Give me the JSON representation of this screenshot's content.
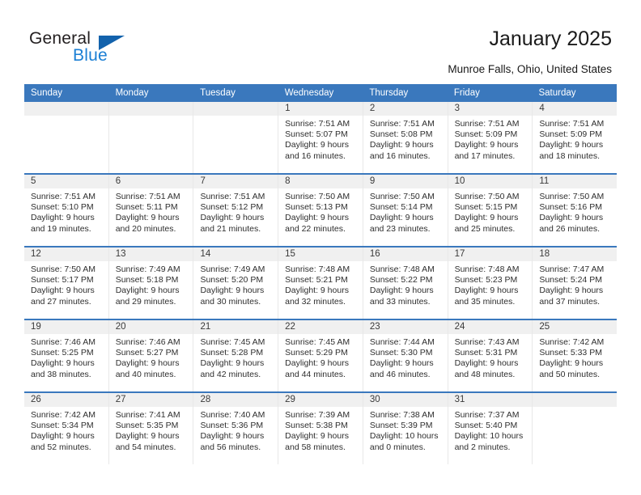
{
  "brand": {
    "name_top": "General",
    "name_bottom": "Blue",
    "accent_color": "#1262ac",
    "text_color": "#231f20"
  },
  "header": {
    "title": "January 2025",
    "subtitle": "Munroe Falls, Ohio, United States"
  },
  "calendar": {
    "header_bg": "#3a78bd",
    "daynum_bg": "#f0f0f0",
    "day_headers": [
      "Sunday",
      "Monday",
      "Tuesday",
      "Wednesday",
      "Thursday",
      "Friday",
      "Saturday"
    ],
    "weeks": [
      [
        {
          "day": "",
          "empty": true
        },
        {
          "day": "",
          "empty": true
        },
        {
          "day": "",
          "empty": true
        },
        {
          "day": "1",
          "sunrise": "Sunrise: 7:51 AM",
          "sunset": "Sunset: 5:07 PM",
          "daylight": "Daylight: 9 hours and 16 minutes."
        },
        {
          "day": "2",
          "sunrise": "Sunrise: 7:51 AM",
          "sunset": "Sunset: 5:08 PM",
          "daylight": "Daylight: 9 hours and 16 minutes."
        },
        {
          "day": "3",
          "sunrise": "Sunrise: 7:51 AM",
          "sunset": "Sunset: 5:09 PM",
          "daylight": "Daylight: 9 hours and 17 minutes."
        },
        {
          "day": "4",
          "sunrise": "Sunrise: 7:51 AM",
          "sunset": "Sunset: 5:09 PM",
          "daylight": "Daylight: 9 hours and 18 minutes."
        }
      ],
      [
        {
          "day": "5",
          "sunrise": "Sunrise: 7:51 AM",
          "sunset": "Sunset: 5:10 PM",
          "daylight": "Daylight: 9 hours and 19 minutes."
        },
        {
          "day": "6",
          "sunrise": "Sunrise: 7:51 AM",
          "sunset": "Sunset: 5:11 PM",
          "daylight": "Daylight: 9 hours and 20 minutes."
        },
        {
          "day": "7",
          "sunrise": "Sunrise: 7:51 AM",
          "sunset": "Sunset: 5:12 PM",
          "daylight": "Daylight: 9 hours and 21 minutes."
        },
        {
          "day": "8",
          "sunrise": "Sunrise: 7:50 AM",
          "sunset": "Sunset: 5:13 PM",
          "daylight": "Daylight: 9 hours and 22 minutes."
        },
        {
          "day": "9",
          "sunrise": "Sunrise: 7:50 AM",
          "sunset": "Sunset: 5:14 PM",
          "daylight": "Daylight: 9 hours and 23 minutes."
        },
        {
          "day": "10",
          "sunrise": "Sunrise: 7:50 AM",
          "sunset": "Sunset: 5:15 PM",
          "daylight": "Daylight: 9 hours and 25 minutes."
        },
        {
          "day": "11",
          "sunrise": "Sunrise: 7:50 AM",
          "sunset": "Sunset: 5:16 PM",
          "daylight": "Daylight: 9 hours and 26 minutes."
        }
      ],
      [
        {
          "day": "12",
          "sunrise": "Sunrise: 7:50 AM",
          "sunset": "Sunset: 5:17 PM",
          "daylight": "Daylight: 9 hours and 27 minutes."
        },
        {
          "day": "13",
          "sunrise": "Sunrise: 7:49 AM",
          "sunset": "Sunset: 5:18 PM",
          "daylight": "Daylight: 9 hours and 29 minutes."
        },
        {
          "day": "14",
          "sunrise": "Sunrise: 7:49 AM",
          "sunset": "Sunset: 5:20 PM",
          "daylight": "Daylight: 9 hours and 30 minutes."
        },
        {
          "day": "15",
          "sunrise": "Sunrise: 7:48 AM",
          "sunset": "Sunset: 5:21 PM",
          "daylight": "Daylight: 9 hours and 32 minutes."
        },
        {
          "day": "16",
          "sunrise": "Sunrise: 7:48 AM",
          "sunset": "Sunset: 5:22 PM",
          "daylight": "Daylight: 9 hours and 33 minutes."
        },
        {
          "day": "17",
          "sunrise": "Sunrise: 7:48 AM",
          "sunset": "Sunset: 5:23 PM",
          "daylight": "Daylight: 9 hours and 35 minutes."
        },
        {
          "day": "18",
          "sunrise": "Sunrise: 7:47 AM",
          "sunset": "Sunset: 5:24 PM",
          "daylight": "Daylight: 9 hours and 37 minutes."
        }
      ],
      [
        {
          "day": "19",
          "sunrise": "Sunrise: 7:46 AM",
          "sunset": "Sunset: 5:25 PM",
          "daylight": "Daylight: 9 hours and 38 minutes."
        },
        {
          "day": "20",
          "sunrise": "Sunrise: 7:46 AM",
          "sunset": "Sunset: 5:27 PM",
          "daylight": "Daylight: 9 hours and 40 minutes."
        },
        {
          "day": "21",
          "sunrise": "Sunrise: 7:45 AM",
          "sunset": "Sunset: 5:28 PM",
          "daylight": "Daylight: 9 hours and 42 minutes."
        },
        {
          "day": "22",
          "sunrise": "Sunrise: 7:45 AM",
          "sunset": "Sunset: 5:29 PM",
          "daylight": "Daylight: 9 hours and 44 minutes."
        },
        {
          "day": "23",
          "sunrise": "Sunrise: 7:44 AM",
          "sunset": "Sunset: 5:30 PM",
          "daylight": "Daylight: 9 hours and 46 minutes."
        },
        {
          "day": "24",
          "sunrise": "Sunrise: 7:43 AM",
          "sunset": "Sunset: 5:31 PM",
          "daylight": "Daylight: 9 hours and 48 minutes."
        },
        {
          "day": "25",
          "sunrise": "Sunrise: 7:42 AM",
          "sunset": "Sunset: 5:33 PM",
          "daylight": "Daylight: 9 hours and 50 minutes."
        }
      ],
      [
        {
          "day": "26",
          "sunrise": "Sunrise: 7:42 AM",
          "sunset": "Sunset: 5:34 PM",
          "daylight": "Daylight: 9 hours and 52 minutes."
        },
        {
          "day": "27",
          "sunrise": "Sunrise: 7:41 AM",
          "sunset": "Sunset: 5:35 PM",
          "daylight": "Daylight: 9 hours and 54 minutes."
        },
        {
          "day": "28",
          "sunrise": "Sunrise: 7:40 AM",
          "sunset": "Sunset: 5:36 PM",
          "daylight": "Daylight: 9 hours and 56 minutes."
        },
        {
          "day": "29",
          "sunrise": "Sunrise: 7:39 AM",
          "sunset": "Sunset: 5:38 PM",
          "daylight": "Daylight: 9 hours and 58 minutes."
        },
        {
          "day": "30",
          "sunrise": "Sunrise: 7:38 AM",
          "sunset": "Sunset: 5:39 PM",
          "daylight": "Daylight: 10 hours and 0 minutes."
        },
        {
          "day": "31",
          "sunrise": "Sunrise: 7:37 AM",
          "sunset": "Sunset: 5:40 PM",
          "daylight": "Daylight: 10 hours and 2 minutes."
        },
        {
          "day": "",
          "empty": true
        }
      ]
    ]
  }
}
